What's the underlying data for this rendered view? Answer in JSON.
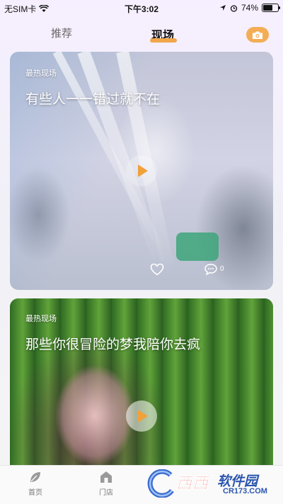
{
  "status_bar": {
    "carrier": "无SIM卡",
    "time": "下午3:02",
    "battery": "74%",
    "battery_level": 0.74
  },
  "tabs": {
    "recommend": "推荐",
    "live": "现场",
    "active": "live"
  },
  "cards": [
    {
      "label": "最热现场",
      "title": "有些人一一错过就不在",
      "comment_count": "0"
    },
    {
      "label": "最热现场",
      "title": "那些你很冒险的梦我陪你去疯"
    }
  ],
  "bottom_nav": {
    "home": "首页",
    "store": "门店"
  },
  "watermark": {
    "brand": "西西",
    "site": "软件园",
    "url": "CR173.COM"
  },
  "colors": {
    "accent": "#f2a64b",
    "play": "#f0a13a"
  }
}
